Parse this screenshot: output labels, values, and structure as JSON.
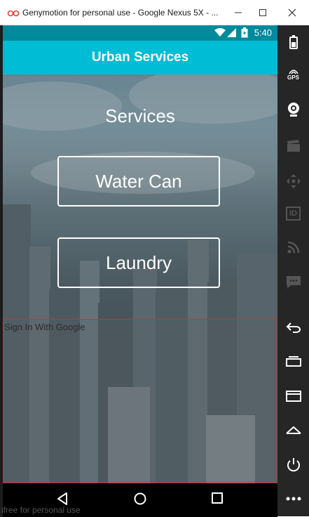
{
  "window": {
    "title": "Genymotion for personal use - Google Nexus 5X - ...",
    "accent": "#e53935"
  },
  "statusbar": {
    "time": "5:40",
    "color": "#008a9c",
    "icons": [
      "wifi-icon",
      "signal-icon",
      "battery-icon"
    ]
  },
  "appbar": {
    "title": "Urban Services",
    "color": "#00bcd4"
  },
  "main": {
    "heading": "Services",
    "buttons": [
      {
        "label": "Water Can"
      },
      {
        "label": "Laundry"
      }
    ],
    "google_signin_label": "Sign In With Google"
  },
  "navbar": {
    "icons": [
      "back-icon",
      "home-icon",
      "recent-apps-icon"
    ]
  },
  "sidebar": {
    "icons": [
      "battery-icon",
      "gps-icon",
      "webcam-icon",
      "clapper-icon",
      "dpad-icon",
      "id-icon",
      "rss-icon",
      "sms-icon",
      "back-icon",
      "recent-apps-icon",
      "menu-icon",
      "home-icon",
      "power-icon",
      "more-icon"
    ],
    "gps_label": "GPS",
    "id_label": "ID"
  },
  "footer": {
    "text": "ifree for personal use"
  }
}
